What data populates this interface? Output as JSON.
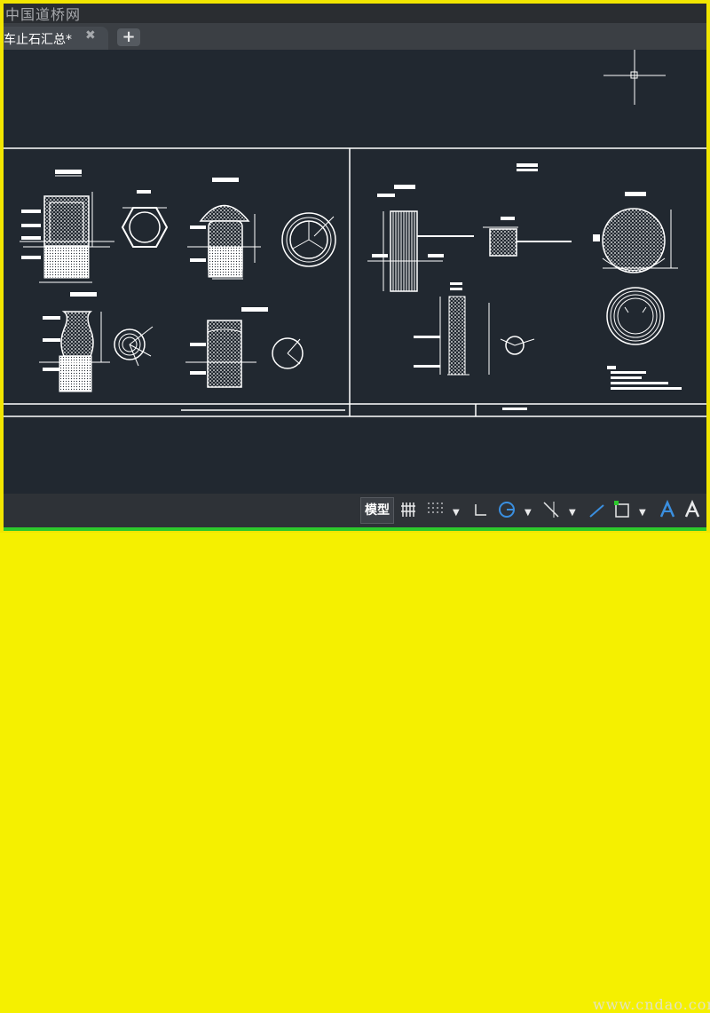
{
  "watermark_top": "中国道桥网",
  "watermark_bottom": "www.cndao.com",
  "tabs": [
    {
      "label": "车止石汇总*",
      "active": true
    }
  ],
  "statusbar": {
    "model_label": "模型"
  },
  "colors": {
    "canvas": "#212830",
    "border": "#f2e600",
    "accent_blue": "#3a8fe0",
    "status_green": "#2cc92c"
  },
  "icons": [
    "close-icon",
    "plus-icon",
    "grid-icon",
    "snap-grid-icon",
    "ortho-icon",
    "polar-icon",
    "osnap-icon",
    "isodraft-icon",
    "selection-cycling-icon",
    "annotation-icon",
    "tools-icon"
  ]
}
